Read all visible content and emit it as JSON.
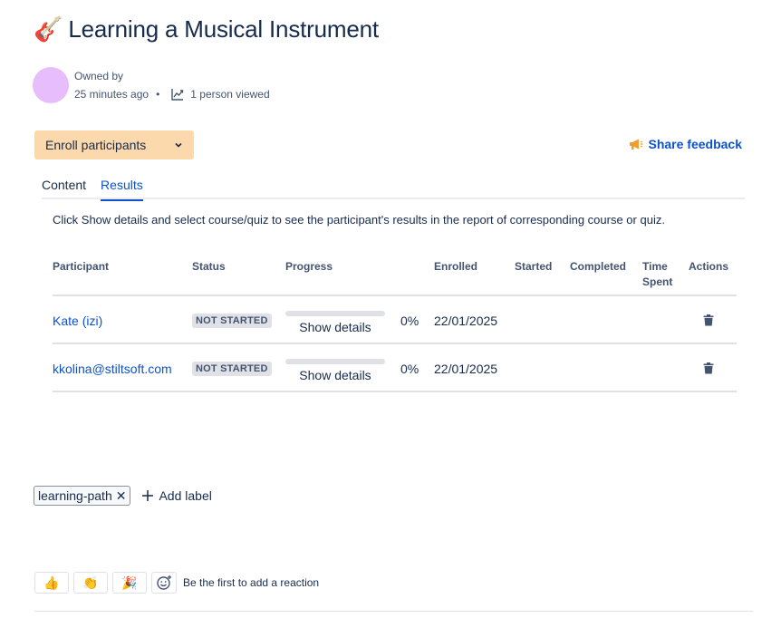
{
  "page": {
    "emoji": "🎸",
    "title": "Learning a Musical Instrument"
  },
  "byline": {
    "owned_by_label": "Owned by",
    "time": "25 minutes ago",
    "separator": "•",
    "views": "1 person viewed"
  },
  "toolbar": {
    "enroll_label": "Enroll participants",
    "feedback_label": "Share feedback"
  },
  "tabs": [
    {
      "label": "Content",
      "active": false
    },
    {
      "label": "Results",
      "active": true
    }
  ],
  "hint": "Click Show details and select course/quiz to see the participant's results in the report of corresponding course or quiz.",
  "table": {
    "headers": {
      "participant": "Participant",
      "status": "Status",
      "progress": "Progress",
      "enrolled": "Enrolled",
      "started": "Started",
      "completed": "Completed",
      "time_spent_1": "Time",
      "time_spent_2": "Spent",
      "actions": "Actions"
    },
    "rows": [
      {
        "participant": "Kate (izi)",
        "status": "NOT STARTED",
        "progress_value": 0,
        "progress_text": "0%",
        "show_details": "Show details",
        "enrolled": "22/01/2025",
        "started": "",
        "completed": "",
        "time_spent": ""
      },
      {
        "participant": "kkolina@stiltsoft.com",
        "status": "NOT STARTED",
        "progress_value": 0,
        "progress_text": "0%",
        "show_details": "Show details",
        "enrolled": "22/01/2025",
        "started": "",
        "completed": "",
        "time_spent": ""
      }
    ]
  },
  "labels": {
    "items": [
      "learning-path"
    ],
    "add_label": "Add label"
  },
  "reactions": {
    "buttons": [
      "👍",
      "👏",
      "🎉"
    ],
    "prompt": "Be the first to add a reaction"
  },
  "colors": {
    "accent": "#0c52cc",
    "enroll_bg": "#fcd9ad",
    "avatar": "#e8bdfb",
    "feedback_icon": "#f29d2b"
  }
}
